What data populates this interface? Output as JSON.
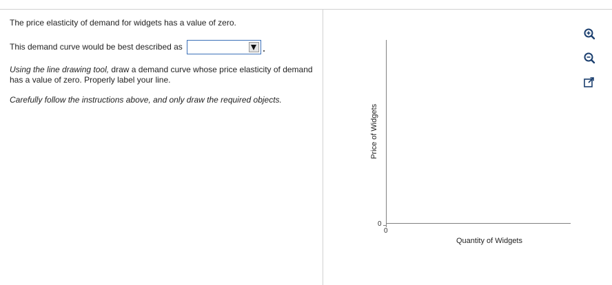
{
  "question": {
    "line1": "The price elasticity of demand for widgets has a value of zero.",
    "line2_prefix": "This demand curve would be best described as",
    "dropdown_value": "",
    "line3_italic": "Using the line drawing tool,",
    "line3_rest": " draw a demand curve whose price elasticity of demand has a value of zero.  Properly label your line.",
    "line4": "Carefully follow the instructions above, and only draw the required objects."
  },
  "graph": {
    "y_label": "Price of Widgets",
    "x_label": "Quantity of Widgets",
    "y_tick": "0",
    "x_tick": "0"
  },
  "tools": [
    {
      "icon": "zoom-in-icon"
    },
    {
      "icon": "zoom-out-icon"
    },
    {
      "icon": "expand-icon"
    }
  ],
  "colors": {
    "dropdown_border": "#3a6fb8",
    "axis": "#808080"
  }
}
